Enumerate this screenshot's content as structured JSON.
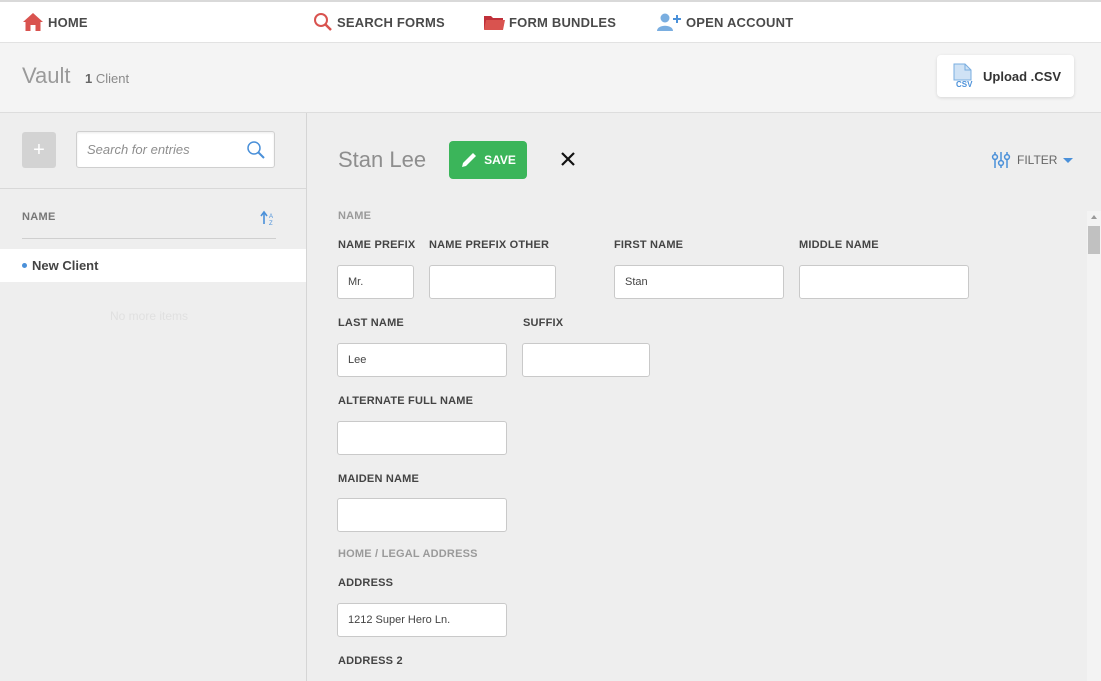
{
  "nav": {
    "home": "HOME",
    "search_forms": "SEARCH FORMS",
    "form_bundles": "FORM BUNDLES",
    "open_account": "OPEN ACCOUNT"
  },
  "vault": {
    "title": "Vault",
    "count": "1",
    "count_label": "Client",
    "upload_label": "Upload .CSV"
  },
  "sidebar": {
    "search_placeholder": "Search for entries",
    "column_header": "NAME",
    "items": [
      {
        "label": "New Client"
      }
    ],
    "empty_text": "No more items"
  },
  "form": {
    "client_name": "Stan Lee",
    "save_label": "SAVE",
    "filter_label": "FILTER",
    "sections": {
      "name": "NAME",
      "address": "HOME / LEGAL ADDRESS"
    },
    "fields": {
      "name_prefix": {
        "label": "NAME PREFIX",
        "value": "Mr."
      },
      "name_prefix_other": {
        "label": "NAME PREFIX OTHER",
        "value": ""
      },
      "first_name": {
        "label": "FIRST NAME",
        "value": "Stan"
      },
      "middle_name": {
        "label": "MIDDLE NAME",
        "value": ""
      },
      "last_name": {
        "label": "LAST NAME",
        "value": "Lee"
      },
      "suffix": {
        "label": "SUFFIX",
        "value": ""
      },
      "alternate_full_name": {
        "label": "ALTERNATE FULL NAME",
        "value": ""
      },
      "maiden_name": {
        "label": "MAIDEN NAME",
        "value": ""
      },
      "address": {
        "label": "ADDRESS",
        "value": "1212 Super Hero Ln."
      },
      "address_2": {
        "label": "ADDRESS 2",
        "value": ""
      }
    }
  },
  "colors": {
    "save_green": "#3bb55a",
    "accent_blue": "#4a90d9",
    "nav_red": "#d9534f"
  }
}
